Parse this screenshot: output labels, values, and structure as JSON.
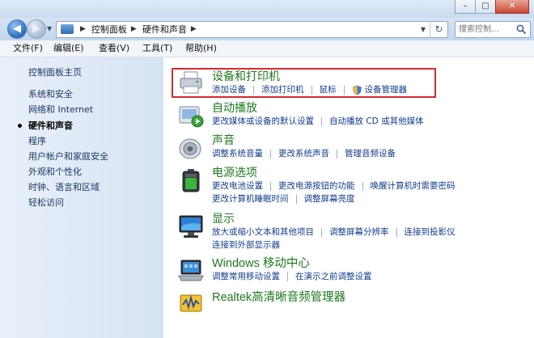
{
  "window": {
    "minimize_glyph": "–",
    "maximize_glyph": "□",
    "close_glyph": "✕"
  },
  "navigation": {
    "back_icon": "back-arrow-icon",
    "forward_icon": "forward-arrow-icon",
    "breadcrumbs": [
      "控制面板",
      "硬件和声音"
    ],
    "search_placeholder": "搜索控制..."
  },
  "menu": [
    "文件(F)",
    "编辑(E)",
    "查看(V)",
    "工具(T)",
    "帮助(H)"
  ],
  "sidebar": {
    "items": [
      {
        "label": "控制面板主页",
        "current": false
      },
      {
        "label": "系统和安全",
        "current": false
      },
      {
        "label": "网络和 Internet",
        "current": false
      },
      {
        "label": "硬件和声音",
        "current": true
      },
      {
        "label": "程序",
        "current": false
      },
      {
        "label": "用户帐户和家庭安全",
        "current": false
      },
      {
        "label": "外观和个性化",
        "current": false
      },
      {
        "label": "时钟、语言和区域",
        "current": false
      },
      {
        "label": "轻松访问",
        "current": false
      }
    ]
  },
  "categories": [
    {
      "title": "设备和打印机",
      "icon": "printer-icon",
      "highlighted": true,
      "rows": [
        [
          "添加设备",
          "添加打印机",
          "鼠标",
          "设备管理器"
        ]
      ]
    },
    {
      "title": "自动播放",
      "icon": "autoplay-icon",
      "rows": [
        [
          "更改媒体或设备的默认设置",
          "自动播放 CD 或其他媒体"
        ]
      ]
    },
    {
      "title": "声音",
      "icon": "speaker-icon",
      "rows": [
        [
          "调整系统音量",
          "更改系统声音",
          "管理音频设备"
        ]
      ]
    },
    {
      "title": "电源选项",
      "icon": "battery-icon",
      "rows": [
        [
          "更改电池设置",
          "更改电源按钮的功能",
          "唤醒计算机时需要密码"
        ],
        [
          "更改计算机睡眠时间",
          "调整屏幕亮度"
        ]
      ]
    },
    {
      "title": "显示",
      "icon": "monitor-icon",
      "rows": [
        [
          "放大或缩小文本和其他项目",
          "调整屏幕分辨率",
          "连接到投影仪"
        ],
        [
          "连接到外部显示器"
        ]
      ]
    },
    {
      "title": "Windows 移动中心",
      "icon": "mobility-center-icon",
      "rows": [
        [
          "调整常用移动设置",
          "在演示之前调整设置"
        ]
      ]
    },
    {
      "title": "Realtek高清晰音频管理器",
      "icon": "realtek-audio-icon",
      "rows": []
    }
  ],
  "colors": {
    "category_title": "#1c7a1c",
    "task_link": "#0f3d8c",
    "highlight_box": "#d9272e"
  }
}
